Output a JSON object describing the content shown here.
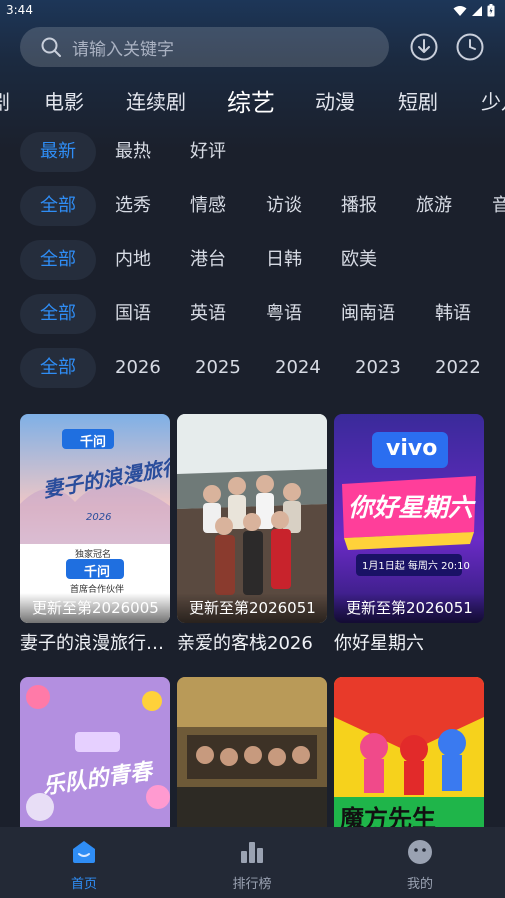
{
  "status": {
    "time": "3:44"
  },
  "search": {
    "placeholder": "请输入关键字"
  },
  "categories": [
    "剧",
    "电影",
    "连续剧",
    "综艺",
    "动漫",
    "短剧",
    "少儿"
  ],
  "filters": {
    "sort": [
      "最新",
      "最热",
      "好评"
    ],
    "type": [
      "全部",
      "选秀",
      "情感",
      "访谈",
      "播报",
      "旅游",
      "音乐"
    ],
    "region": [
      "全部",
      "内地",
      "港台",
      "日韩",
      "欧美"
    ],
    "language": [
      "全部",
      "国语",
      "英语",
      "粤语",
      "闽南语",
      "韩语"
    ],
    "year": [
      "全部",
      "2026",
      "2025",
      "2024",
      "2023",
      "2022"
    ]
  },
  "cards": [
    {
      "title": "妻子的浪漫旅行…",
      "update": "更新至第2026005",
      "poster_text": [
        "千问",
        "妻子的浪漫旅行",
        "2026",
        "独家冠名",
        "千问",
        "首席合作伙伴"
      ]
    },
    {
      "title": "亲爱的客栈2026",
      "update": "更新至第2026051",
      "poster_text": []
    },
    {
      "title": "你好星期六",
      "update": "更新至第2026051",
      "poster_text": [
        "vivo",
        "你好星期六",
        "1月1日起 每周六 20:10"
      ]
    },
    {
      "title": "",
      "update": "",
      "poster_text": [
        "乐队的青春"
      ]
    },
    {
      "title": "",
      "update": "",
      "poster_text": []
    },
    {
      "title": "",
      "update": "",
      "poster_text": [
        "魔方先生"
      ]
    }
  ],
  "tabs": [
    {
      "label": "首页",
      "icon": "home-icon",
      "active": true
    },
    {
      "label": "排行榜",
      "icon": "chart-icon",
      "active": false
    },
    {
      "label": "我的",
      "icon": "profile-icon",
      "active": false
    }
  ],
  "colors": {
    "accent": "#2f8df5",
    "background": "#1b202c",
    "chip": "#252d3c"
  }
}
